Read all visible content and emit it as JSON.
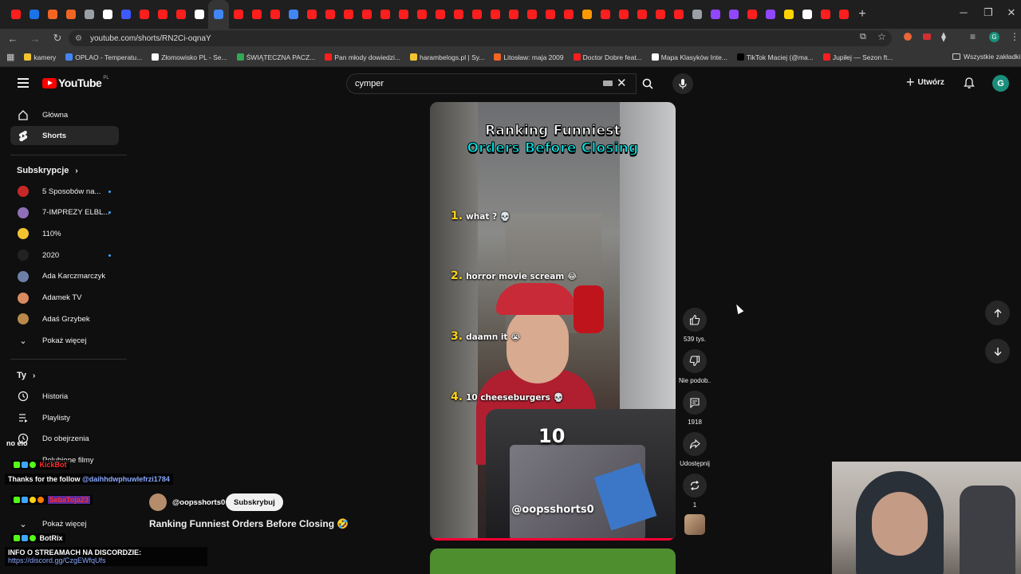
{
  "browser": {
    "url": "youtube.com/shorts/RN2Ci-oqnaY",
    "tab_colors": [
      "#ff1e1e",
      "#1a73e8",
      "#f26522",
      "#f26522",
      "#9aa0a6",
      "#ffffff",
      "#3d5afe",
      "#ff1e1e",
      "#ff1e1e",
      "#ff1e1e",
      "#ffffff",
      "#4285f4",
      "#ff1e1e",
      "#ff1e1e",
      "#ff1e1e",
      "#4285f4",
      "#ff1e1e",
      "#ff1e1e",
      "#ff1e1e",
      "#ff1e1e",
      "#ff1e1e",
      "#ff1e1e",
      "#ff1e1e",
      "#ff1e1e",
      "#ff1e1e",
      "#ff1e1e",
      "#ff1e1e",
      "#ff1e1e",
      "#ff1e1e",
      "#ff1e1e",
      "#ff1e1e",
      "#ff9900",
      "#ff1e1e",
      "#ff1e1e",
      "#ff1e1e",
      "#ff1e1e",
      "#ff1e1e",
      "#9aa0a6",
      "#9146ff",
      "#9146ff",
      "#ff1e1e",
      "#9146ff",
      "#ffd200",
      "#ffffff",
      "#ff1e1e",
      "#ff1e1e"
    ],
    "bookmarks": [
      {
        "label": "kamery",
        "color": "#f4c430"
      },
      {
        "label": "OPLAO - Temperatu...",
        "color": "#4285f4"
      },
      {
        "label": "Złomowisko PL - Se...",
        "color": "#ffffff"
      },
      {
        "label": "ŚWIĄTECZNA PACZ...",
        "color": "#34a853"
      },
      {
        "label": "Pan młody dowiedzi...",
        "color": "#ff1e1e"
      },
      {
        "label": "harambelogs.pl | Sy...",
        "color": "#f4c430"
      },
      {
        "label": "Litosław: maja 2009",
        "color": "#f26522"
      },
      {
        "label": "Doctor Dobre feat...",
        "color": "#ff1e1e"
      },
      {
        "label": "Mapa Klasyków Inte...",
        "color": "#ffffff"
      },
      {
        "label": "TikTok Maciej (@ma...",
        "color": "#000000"
      },
      {
        "label": "Jupiłej — Sezon ft...",
        "color": "#ff1e1e"
      }
    ],
    "all_bookmarks": "Wszystkie zakładki"
  },
  "header": {
    "logo_text": "YouTube",
    "logo_country": "PL",
    "search_value": "cymper",
    "create_label": "Utwórz",
    "avatar_letter": "G"
  },
  "sidebar": {
    "home": "Główna",
    "shorts": "Shorts",
    "subscriptions_heading": "Subskrypcje",
    "subscriptions": [
      {
        "label": "5 Sposobów na...",
        "color": "#c62828",
        "dot": true
      },
      {
        "label": "7-IMPREZY ELBL...",
        "color": "#8e6fb8",
        "dot": true
      },
      {
        "label": "110%",
        "color": "#f4c430",
        "dot": false
      },
      {
        "label": "2020",
        "color": "#222222",
        "dot": true
      },
      {
        "label": "Ada Karczmarczyk",
        "color": "#6d7fa8",
        "dot": false
      },
      {
        "label": "Adamek TV",
        "color": "#d98b5f",
        "dot": false
      },
      {
        "label": "Adaś Grzybek",
        "color": "#b8894a",
        "dot": false
      }
    ],
    "show_more": "Pokaż więcej",
    "you_heading": "Ty",
    "you_items": [
      "Historia",
      "Playlisty",
      "Do obejrzenia",
      "Polubione filmy"
    ],
    "show_more_2": "Pokaż więcej"
  },
  "video": {
    "title_line1": "Ranking Funniest",
    "title_line2": "Orders Before Closing",
    "ranks": [
      {
        "num": "1.",
        "text": "what ? 💀"
      },
      {
        "num": "2.",
        "text": "horror movie scream 😂"
      },
      {
        "num": "3.",
        "text": "daamn it 😭"
      },
      {
        "num": "4.",
        "text": "10 cheeseburgers 💀"
      }
    ],
    "count_overlay": "10",
    "handle_overlay": "@oopsshorts0",
    "progress_fraction": 1.0
  },
  "channel": {
    "handle": "@oopsshorts0",
    "subscribe": "Subskrybuj",
    "short_title": "Ranking Funniest Orders Before Closing 🤣"
  },
  "actions": {
    "likes": "539 tys.",
    "dislike": "Nie podob...",
    "comments": "1918",
    "share": "Udostępnij",
    "remix": "1"
  },
  "stream_overlay": {
    "line_noelo": "no elo",
    "user1": "KickBot",
    "follow_msg": "Thanks for the follow",
    "follow_user": "@daihhdwphuwlefrzi1784",
    "user2": "SebaToja23",
    "user3": "BotRix",
    "discord_msg": "INFO O STREAMACH NA DISCORDZIE:",
    "discord_link": "https://discord.gg/CzgEWfqUfs"
  },
  "colors": {
    "accent_red": "#ff0000",
    "progress_red": "#ff0033",
    "chat_name_red": "#ff2d2d",
    "title_cyan": "#00e6e6",
    "rank_yellow": "#ffd21a"
  }
}
